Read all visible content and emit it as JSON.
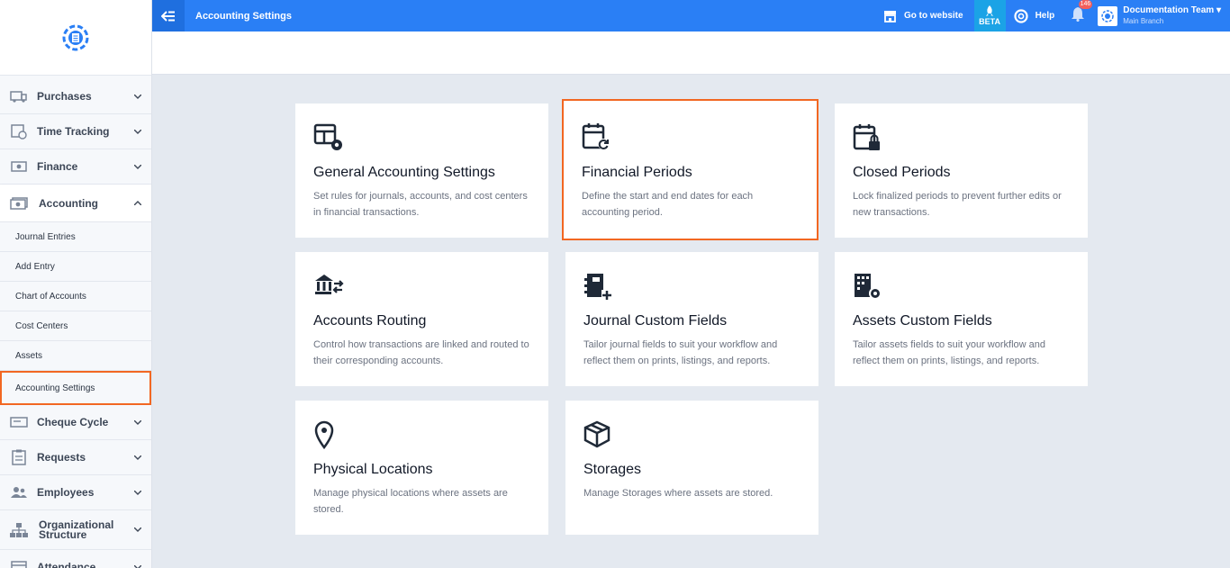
{
  "topbar": {
    "page_title": "Accounting Settings",
    "go_to_website": "Go to website",
    "beta": "BETA",
    "help": "Help",
    "notifications_count": "146",
    "user_name": "Documentation Team",
    "user_branch": "Main Branch"
  },
  "sidebar": {
    "items": [
      {
        "label": "Purchases",
        "icon": "truck-icon"
      },
      {
        "label": "Time Tracking",
        "icon": "calendar-clock-icon"
      },
      {
        "label": "Finance",
        "icon": "money-icon"
      },
      {
        "label": "Accounting",
        "icon": "cash-icon"
      },
      {
        "label": "Cheque Cycle",
        "icon": "cheque-icon"
      },
      {
        "label": "Requests",
        "icon": "clipboard-icon"
      },
      {
        "label": "Employees",
        "icon": "users-icon"
      },
      {
        "label": "Organizational Structure",
        "icon": "org-chart-icon"
      },
      {
        "label": "Attendance",
        "icon": "calendar-icon"
      }
    ],
    "accounting_sub": [
      "Journal Entries",
      "Add Entry",
      "Chart of Accounts",
      "Cost Centers",
      "Assets",
      "Accounting Settings"
    ]
  },
  "cards": [
    {
      "title": "General Accounting Settings",
      "desc": "Set rules for journals, accounts, and cost centers in financial transactions."
    },
    {
      "title": "Financial Periods",
      "desc": "Define the start and end dates for each accounting period."
    },
    {
      "title": "Closed Periods",
      "desc": "Lock finalized periods to prevent further edits or new transactions."
    },
    {
      "title": "Accounts Routing",
      "desc": "Control how transactions are linked and routed to their corresponding accounts."
    },
    {
      "title": "Journal Custom Fields",
      "desc": "Tailor journal fields to suit your workflow and reflect them on prints, listings, and reports."
    },
    {
      "title": "Assets Custom Fields",
      "desc": "Tailor assets fields to suit your workflow and reflect them on prints, listings, and reports."
    },
    {
      "title": "Physical Locations",
      "desc": "Manage physical locations where assets are stored."
    },
    {
      "title": "Storages",
      "desc": "Manage Storages where assets are stored."
    }
  ],
  "colors": {
    "primary": "#2a7ff5",
    "highlight": "#f26722",
    "beta": "#1ba3e6"
  }
}
